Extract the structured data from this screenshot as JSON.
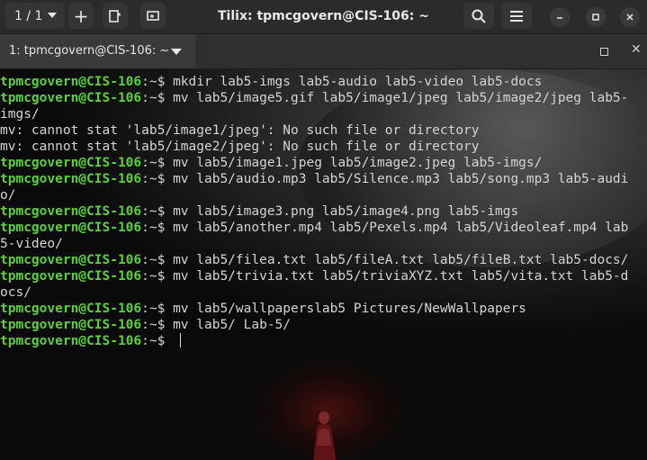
{
  "header": {
    "session_label": "1 / 1",
    "add_label": "+",
    "title": "Tilix: tpmcgovern@CIS-106: ~"
  },
  "tab": {
    "label": "1: tpmcgovern@CIS-106: ~"
  },
  "terminal": {
    "lines": [
      {
        "prompt": "tpmcgovern@CIS-106",
        "path": ":~$ ",
        "text": "mkdir lab5-imgs lab5-audio lab5-video lab5-docs"
      },
      {
        "prompt": "tpmcgovern@CIS-106",
        "path": ":~$ ",
        "text": "mv lab5/image5.gif lab5/image1/jpeg lab5/image2/jpeg lab5-"
      },
      {
        "prompt": "",
        "path": "",
        "text": "imgs/"
      },
      {
        "prompt": "",
        "path": "",
        "text": "mv: cannot stat 'lab5/image1/jpeg': No such file or directory"
      },
      {
        "prompt": "",
        "path": "",
        "text": "mv: cannot stat 'lab5/image2/jpeg': No such file or directory"
      },
      {
        "prompt": "tpmcgovern@CIS-106",
        "path": ":~$ ",
        "text": "mv lab5/image1.jpeg lab5/image2.jpeg lab5-imgs/"
      },
      {
        "prompt": "tpmcgovern@CIS-106",
        "path": ":~$ ",
        "text": "mv lab5/audio.mp3 lab5/Silence.mp3 lab5/song.mp3 lab5-audi"
      },
      {
        "prompt": "",
        "path": "",
        "text": "o/"
      },
      {
        "prompt": "tpmcgovern@CIS-106",
        "path": ":~$ ",
        "text": "mv lab5/image3.png lab5/image4.png lab5-imgs"
      },
      {
        "prompt": "tpmcgovern@CIS-106",
        "path": ":~$ ",
        "text": "mv lab5/another.mp4 lab5/Pexels.mp4 lab5/Videoleaf.mp4 lab"
      },
      {
        "prompt": "",
        "path": "",
        "text": "5-video/"
      },
      {
        "prompt": "tpmcgovern@CIS-106",
        "path": ":~$ ",
        "text": "mv lab5/filea.txt lab5/fileA.txt lab5/fileB.txt lab5-docs/"
      },
      {
        "prompt": "tpmcgovern@CIS-106",
        "path": ":~$ ",
        "text": "mv lab5/trivia.txt lab5/triviaXYZ.txt lab5/vita.txt lab5-d"
      },
      {
        "prompt": "",
        "path": "",
        "text": "ocs/"
      },
      {
        "prompt": "tpmcgovern@CIS-106",
        "path": ":~$ ",
        "text": "mv lab5/wallpaperslab5 Pictures/NewWallpapers"
      },
      {
        "prompt": "tpmcgovern@CIS-106",
        "path": ":~$ ",
        "text": "mv lab5/ Lab-5/"
      },
      {
        "prompt": "tpmcgovern@CIS-106",
        "path": ":~$ ",
        "text": ""
      }
    ]
  },
  "colors": {
    "prompt": "#5ad13a",
    "text": "#d4d4d4",
    "header_bg": "#2b2b2b"
  },
  "icons": [
    "caret-down-icon",
    "plus-icon",
    "split-icon",
    "add-terminal-icon",
    "search-icon",
    "hamburger-icon",
    "minimize-icon",
    "maximize-icon",
    "close-icon"
  ]
}
